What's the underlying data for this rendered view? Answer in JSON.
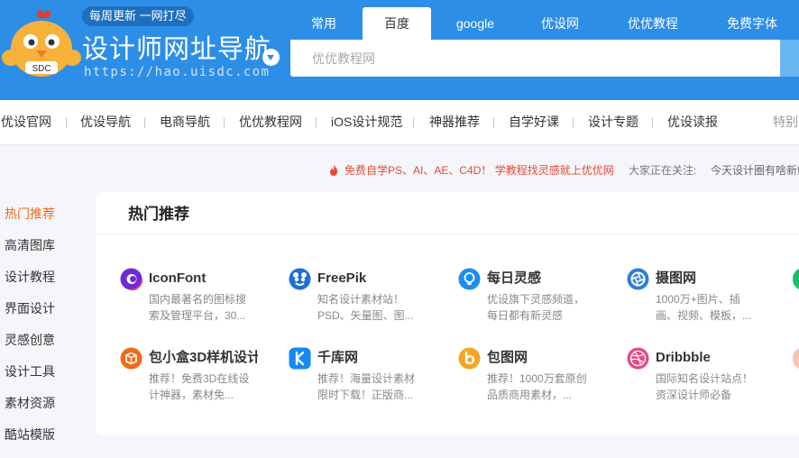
{
  "header": {
    "slogan": "每周更新 一网打尽",
    "title": "设计师网址导航",
    "url": "https://hao.uisdc.com",
    "mascot_badge": "SDC",
    "bg_color": "#2d8ee8"
  },
  "search": {
    "tabs": [
      {
        "label": "常用",
        "active": false
      },
      {
        "label": "百度",
        "active": true
      },
      {
        "label": "google",
        "active": false
      },
      {
        "label": "优设网",
        "active": false
      },
      {
        "label": "优优教程",
        "active": false
      },
      {
        "label": "免费字体",
        "active": false
      }
    ],
    "placeholder": "优优教程网",
    "value": ""
  },
  "nav": {
    "items": [
      "优设官网",
      "优设导航",
      "电商导航",
      "优优教程网",
      "iOS设计规范",
      "神器推荐",
      "自学好课",
      "设计专题",
      "优设读报",
      "特别:"
    ]
  },
  "notice": {
    "hot_text": "免费自学PS、AI、AE、C4D！ 学教程找灵感就上优优网",
    "label": "大家正在关注:",
    "ticker": "今天设计圈有啥新鲜"
  },
  "sidebar": {
    "items": [
      {
        "label": "热门推荐",
        "active": true
      },
      {
        "label": "高清图库",
        "active": false
      },
      {
        "label": "设计教程",
        "active": false
      },
      {
        "label": "界面设计",
        "active": false
      },
      {
        "label": "灵感创意",
        "active": false
      },
      {
        "label": "设计工具",
        "active": false
      },
      {
        "label": "素材资源",
        "active": false
      },
      {
        "label": "酷站模版",
        "active": false
      }
    ],
    "active_color": "#f46b16"
  },
  "hot": {
    "title": "热门推荐",
    "sites": [
      {
        "name": "IconFont",
        "desc": "国内最著名的图标搜索及管理平台，30...",
        "icon": "iconfont-icon",
        "color": "#7b2de0"
      },
      {
        "name": "FreePik",
        "desc": "知名设计素材站！PSD、矢量图、图...",
        "icon": "freepik-icon",
        "color": "#1d6fd8"
      },
      {
        "name": "每日灵感",
        "desc": "优设旗下灵感频道，每日都有新灵感",
        "icon": "lightbulb-icon",
        "color": "#1a8ef0"
      },
      {
        "name": "摄图网",
        "desc": "1000万+图片、插画、视频、模板，...",
        "icon": "camera-aperture-icon",
        "color": "#2d7fd8"
      },
      {
        "name": "包小盒3D样机设计",
        "desc": "推荐！免费3D在线设计神器，素材免...",
        "icon": "box-icon",
        "color": "#f26a1b"
      },
      {
        "name": "千库网",
        "desc": "推荐！海量设计素材限时下载！正版商...",
        "icon": "qianku-icon",
        "color": "#1689f3"
      },
      {
        "name": "包图网",
        "desc": "推荐！1000万套原创品质商用素材，...",
        "icon": "baotu-icon",
        "color": "#f5a623"
      },
      {
        "name": "Dribbble",
        "desc": "国际知名设计站点！资深设计师必备",
        "icon": "dribbble-icon",
        "color": "#e24a86"
      }
    ]
  }
}
